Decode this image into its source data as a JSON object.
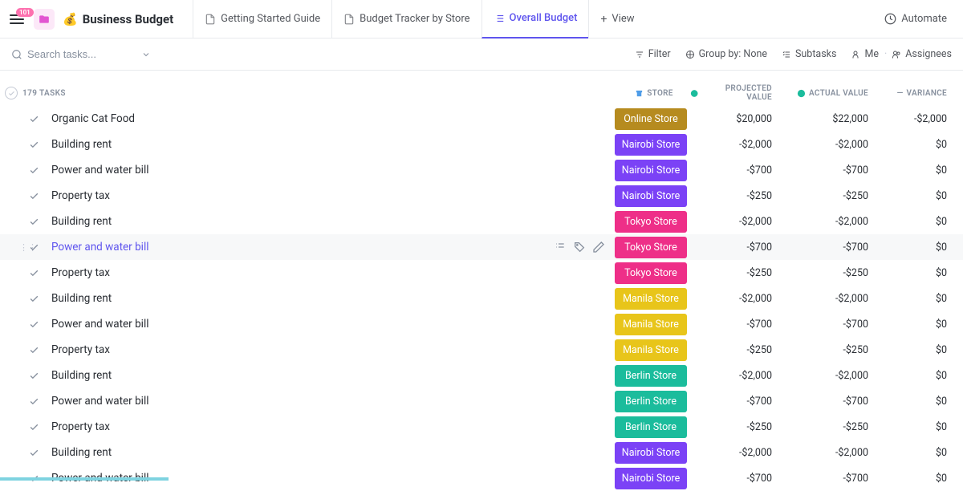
{
  "badge": "101",
  "title": "Business Budget",
  "title_emoji": "💰",
  "tabs": [
    {
      "label": "Getting Started Guide"
    },
    {
      "label": "Budget Tracker by Store"
    },
    {
      "label": "Overall Budget"
    },
    {
      "label": "View"
    }
  ],
  "automate": "Automate",
  "search_placeholder": "Search tasks...",
  "toolbar": {
    "filter": "Filter",
    "group": "Group by: None",
    "subtasks": "Subtasks",
    "me": "Me",
    "assignees": "Assignees"
  },
  "task_count": "179 TASKS",
  "columns": {
    "store": "STORE",
    "projected": "PROJECTED VALUE",
    "actual": "ACTUAL VALUE",
    "variance": "VARIANCE"
  },
  "stores": {
    "online": {
      "label": "Online Store",
      "bg": "#b68b1f"
    },
    "nairobi": {
      "label": "Nairobi Store",
      "bg": "#7b42f6"
    },
    "tokyo": {
      "label": "Tokyo Store",
      "bg": "#ee2f88"
    },
    "manila": {
      "label": "Manila Store",
      "bg": "#e8c51a"
    },
    "berlin": {
      "label": "Berlin Store",
      "bg": "#1bbc9c"
    }
  },
  "rows": [
    {
      "name": "Organic Cat Food",
      "store": "online",
      "projected": "$20,000",
      "actual": "$22,000",
      "variance": "-$2,000"
    },
    {
      "name": "Building rent",
      "store": "nairobi",
      "projected": "-$2,000",
      "actual": "-$2,000",
      "variance": "$0"
    },
    {
      "name": "Power and water bill",
      "store": "nairobi",
      "projected": "-$700",
      "actual": "-$700",
      "variance": "$0"
    },
    {
      "name": "Property tax",
      "store": "nairobi",
      "projected": "-$250",
      "actual": "-$250",
      "variance": "$0"
    },
    {
      "name": "Building rent",
      "store": "tokyo",
      "projected": "-$2,000",
      "actual": "-$2,000",
      "variance": "$0"
    },
    {
      "name": "Power and water bill",
      "store": "tokyo",
      "projected": "-$700",
      "actual": "-$700",
      "variance": "$0",
      "hover": true
    },
    {
      "name": "Property tax",
      "store": "tokyo",
      "projected": "-$250",
      "actual": "-$250",
      "variance": "$0"
    },
    {
      "name": "Building rent",
      "store": "manila",
      "projected": "-$2,000",
      "actual": "-$2,000",
      "variance": "$0"
    },
    {
      "name": "Power and water bill",
      "store": "manila",
      "projected": "-$700",
      "actual": "-$700",
      "variance": "$0"
    },
    {
      "name": "Property tax",
      "store": "manila",
      "projected": "-$250",
      "actual": "-$250",
      "variance": "$0"
    },
    {
      "name": "Building rent",
      "store": "berlin",
      "projected": "-$2,000",
      "actual": "-$2,000",
      "variance": "$0"
    },
    {
      "name": "Power and water bill",
      "store": "berlin",
      "projected": "-$700",
      "actual": "-$700",
      "variance": "$0"
    },
    {
      "name": "Property tax",
      "store": "berlin",
      "projected": "-$250",
      "actual": "-$250",
      "variance": "$0"
    },
    {
      "name": "Building rent",
      "store": "nairobi",
      "projected": "-$2,000",
      "actual": "-$2,000",
      "variance": "$0"
    },
    {
      "name": "Power and water bill",
      "store": "nairobi",
      "projected": "-$700",
      "actual": "-$700",
      "variance": "$0"
    }
  ]
}
